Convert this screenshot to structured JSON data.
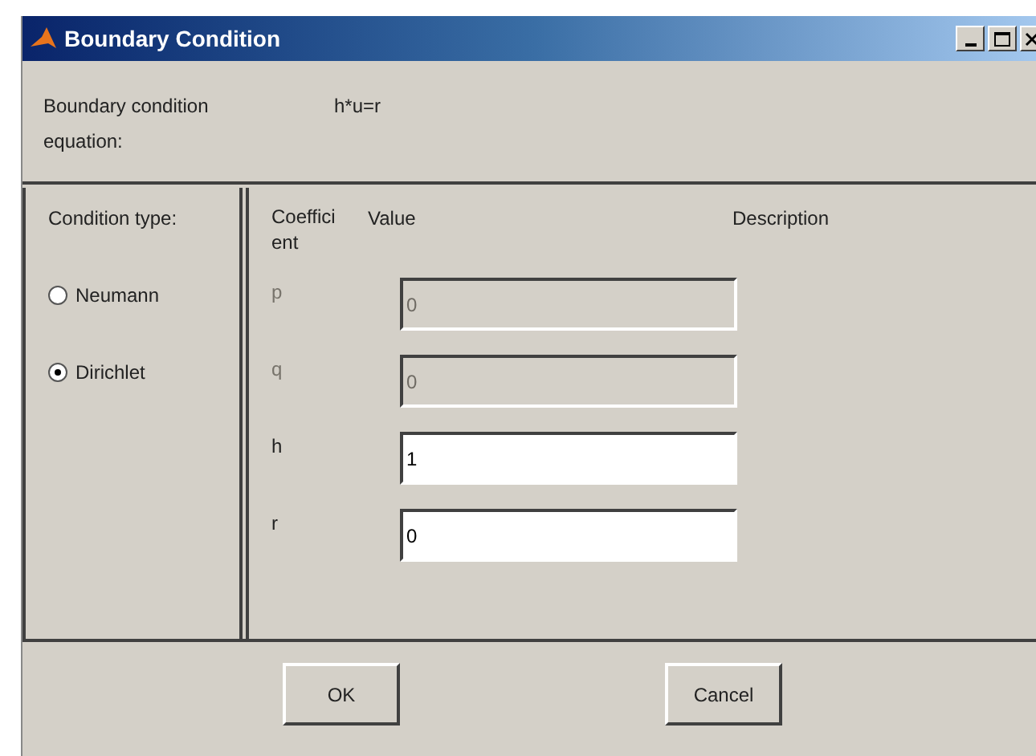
{
  "window": {
    "title": "Boundary Condition"
  },
  "equation": {
    "label": "Boundary condition equation:",
    "value": "h*u=r"
  },
  "condition_type": {
    "label": "Condition type:",
    "options": [
      {
        "label": "Neumann",
        "selected": false
      },
      {
        "label": "Dirichlet",
        "selected": true
      }
    ]
  },
  "coefficients": {
    "columns": [
      "Coefficient",
      "Value",
      "Description"
    ],
    "rows": [
      {
        "name": "p",
        "value": "0",
        "disabled": true
      },
      {
        "name": "q",
        "value": "0",
        "disabled": true
      },
      {
        "name": "h",
        "value": "1",
        "disabled": false
      },
      {
        "name": "r",
        "value": "0",
        "disabled": false
      }
    ]
  },
  "buttons": [
    "OK",
    "Cancel"
  ]
}
